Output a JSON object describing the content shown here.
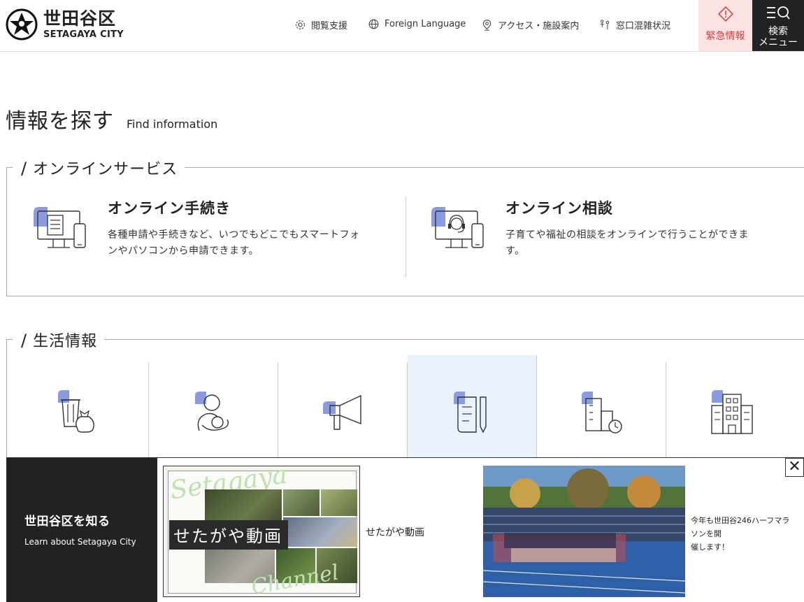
{
  "header": {
    "logo_ja": "世田谷区",
    "logo_en": "SETAGAYA CITY",
    "nav": [
      {
        "label": "閲覧支援",
        "icon": "gear-icon"
      },
      {
        "label": "Foreign Language",
        "icon": "globe-icon"
      },
      {
        "label": "アクセス・施設案内",
        "icon": "map-pin-icon"
      },
      {
        "label": "窓口混雑状況",
        "icon": "people-queue-icon"
      }
    ],
    "emergency_label": "緊急情報",
    "search_menu_line1": "検索",
    "search_menu_line2": "メニュー",
    "colors": {
      "emergency_bg": "#fce3e3",
      "emergency_text": "#d43b3b",
      "menu_bg": "#222222"
    }
  },
  "page_title": {
    "ja": "情報を探す",
    "en": "Find information"
  },
  "online_services": {
    "heading": "オンラインサービス",
    "items": [
      {
        "title": "オンライン手続き",
        "desc_line1": "各種申請や手続きなど、いつでもどこでもスマートフォ",
        "desc_line2": "ンやパソコンから申請できます。",
        "icon": "online-procedure-icon"
      },
      {
        "title": "オンライン相談",
        "desc_line1": "子育てや福祉の相談をオンラインで行うことができま",
        "desc_line2": "す。",
        "icon": "online-consultation-icon"
      }
    ]
  },
  "life_info": {
    "heading": "生活情報",
    "icons": [
      "garbage-recycling-icon",
      "childcare-icon",
      "megaphone-icon",
      "document-pen-icon",
      "building-clock-icon",
      "office-building-icon"
    ],
    "active_index": 3,
    "accent_color": "#8a9be0",
    "active_bg": "#eaf2fd"
  },
  "banner": {
    "title": "世田谷区を知る",
    "subtitle": "Learn about Setagaya City",
    "video_caption": "せたがや動画",
    "video_script_top": "Setagaya",
    "video_script_bottom": "Channel",
    "video_label": "せたがや動画",
    "marathon_line1": "今年も世田谷246ハーフマラソンを開",
    "marathon_line2": "催します！",
    "close_label": "✕"
  }
}
